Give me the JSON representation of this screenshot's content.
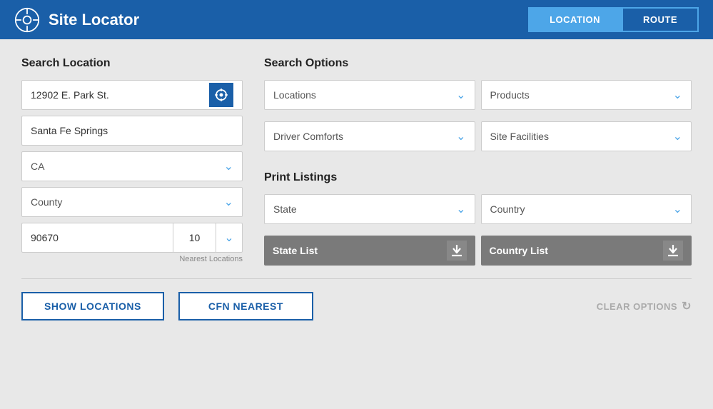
{
  "header": {
    "title": "Site Locator",
    "location_btn": "LOCATION",
    "route_btn": "ROUTE"
  },
  "search_location": {
    "section_title": "Search Location",
    "address_value": "12902 E. Park St.",
    "city_value": "Santa Fe Springs",
    "state_value": "CA",
    "county_placeholder": "County",
    "zip_value": "90670",
    "nearest_value": "10",
    "nearest_label": "Nearest Locations"
  },
  "search_options": {
    "section_title": "Search Options",
    "locations_label": "Locations",
    "products_label": "Products",
    "driver_comforts_label": "Driver Comforts",
    "site_facilities_label": "Site Facilities"
  },
  "print_listings": {
    "section_title": "Print Listings",
    "state_label": "State",
    "country_label": "Country",
    "state_list_btn": "State List",
    "country_list_btn": "Country List"
  },
  "bottom": {
    "show_locations_btn": "SHOW LOCATIONS",
    "cfn_nearest_btn": "CFN NEAREST",
    "clear_options_btn": "CLEAR OPTIONS"
  },
  "icons": {
    "locator": "⊕",
    "chevron_down": "⌄",
    "download": "⬇",
    "refresh": "↻"
  }
}
